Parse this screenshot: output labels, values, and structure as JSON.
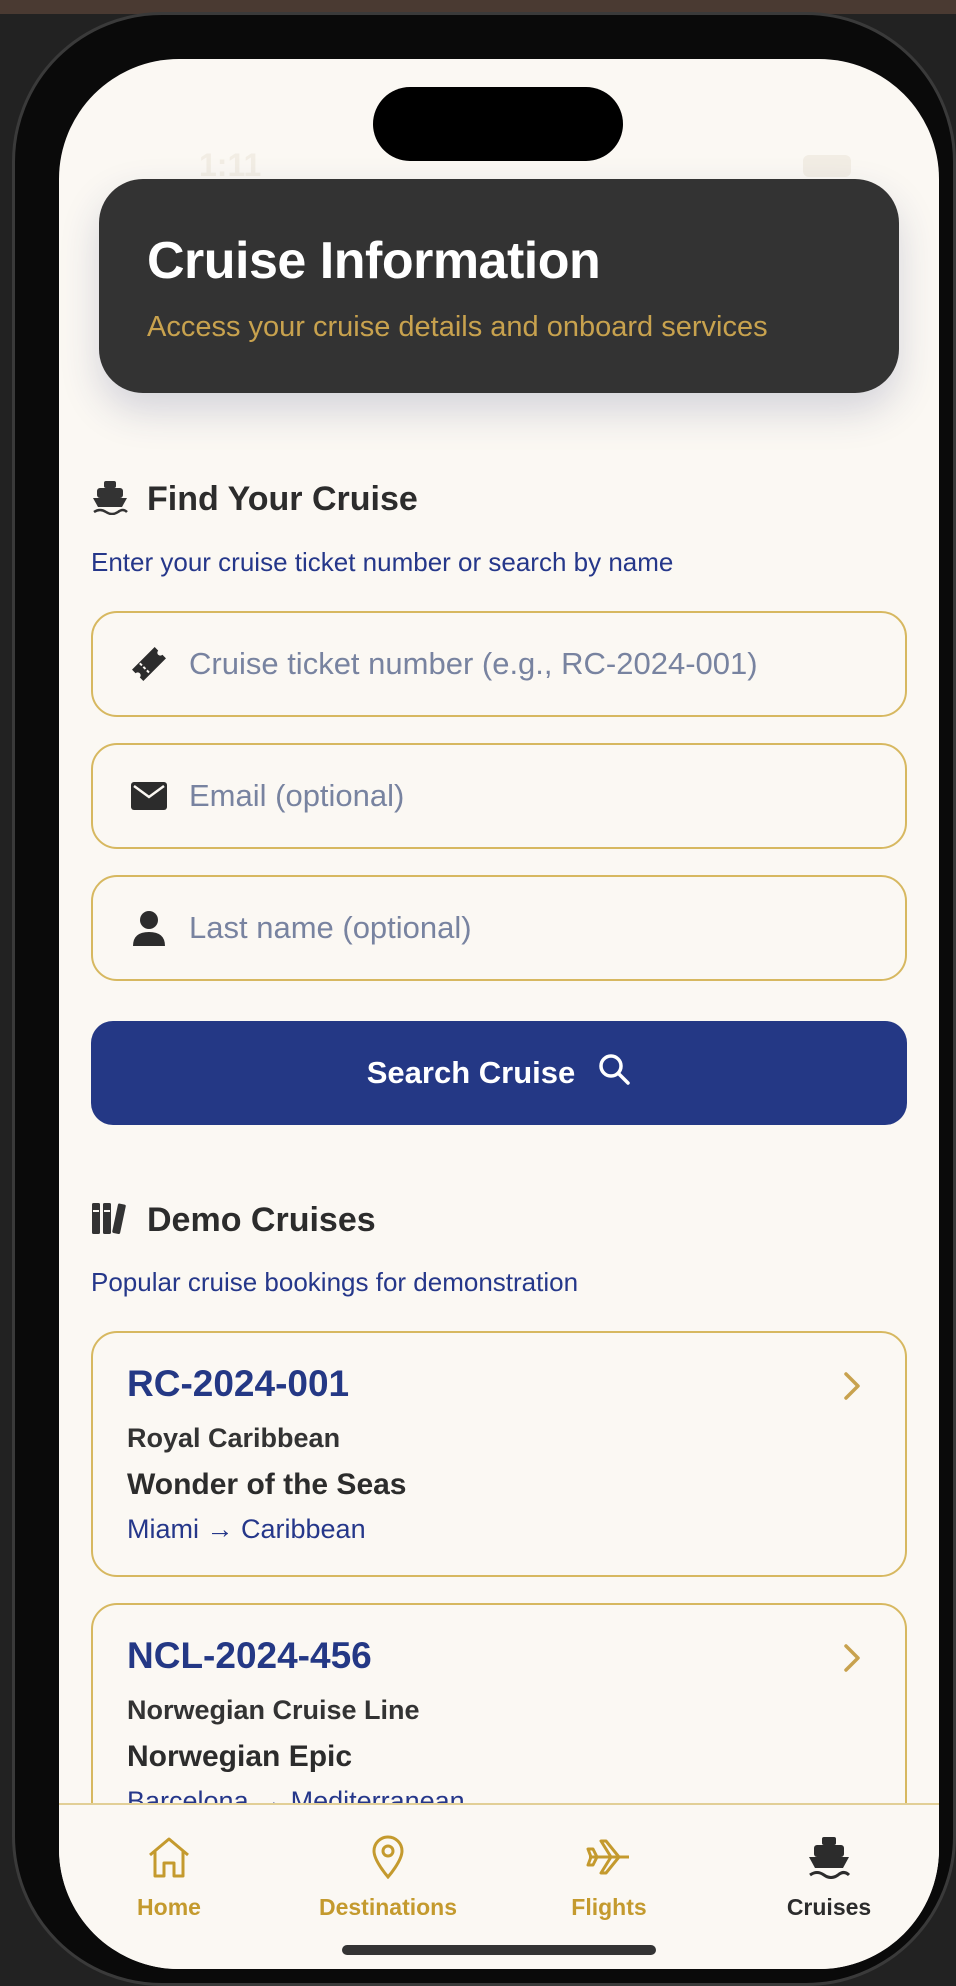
{
  "status": {
    "time": "1:11"
  },
  "header": {
    "title": "Cruise Information",
    "subtitle": "Access your cruise details and onboard services"
  },
  "find": {
    "title": "Find Your Cruise",
    "subtitle": "Enter your cruise ticket number or search by name",
    "ticket_placeholder": "Cruise ticket number (e.g., RC-2024-001)",
    "email_placeholder": "Email (optional)",
    "lastname_placeholder": "Last name (optional)",
    "search_label": "Search Cruise"
  },
  "demo": {
    "title": "Demo Cruises",
    "subtitle": "Popular cruise bookings for demonstration",
    "cruises": [
      {
        "code": "RC-2024-001",
        "line": "Royal Caribbean",
        "ship": "Wonder of the Seas",
        "route": "Miami → Caribbean"
      },
      {
        "code": "NCL-2024-456",
        "line": "Norwegian Cruise Line",
        "ship": "Norwegian Epic",
        "route": "Barcelona → Mediterranean"
      }
    ]
  },
  "tabs": [
    {
      "label": "Home",
      "icon": "home-icon",
      "active": false
    },
    {
      "label": "Destinations",
      "icon": "map-pin-icon",
      "active": false
    },
    {
      "label": "Flights",
      "icon": "plane-icon",
      "active": false
    },
    {
      "label": "Cruises",
      "icon": "ship-icon",
      "active": true
    }
  ],
  "colors": {
    "primary": "#243885",
    "gold": "#c8a24e",
    "header_bg": "#333333",
    "background": "#fbf8f3"
  }
}
